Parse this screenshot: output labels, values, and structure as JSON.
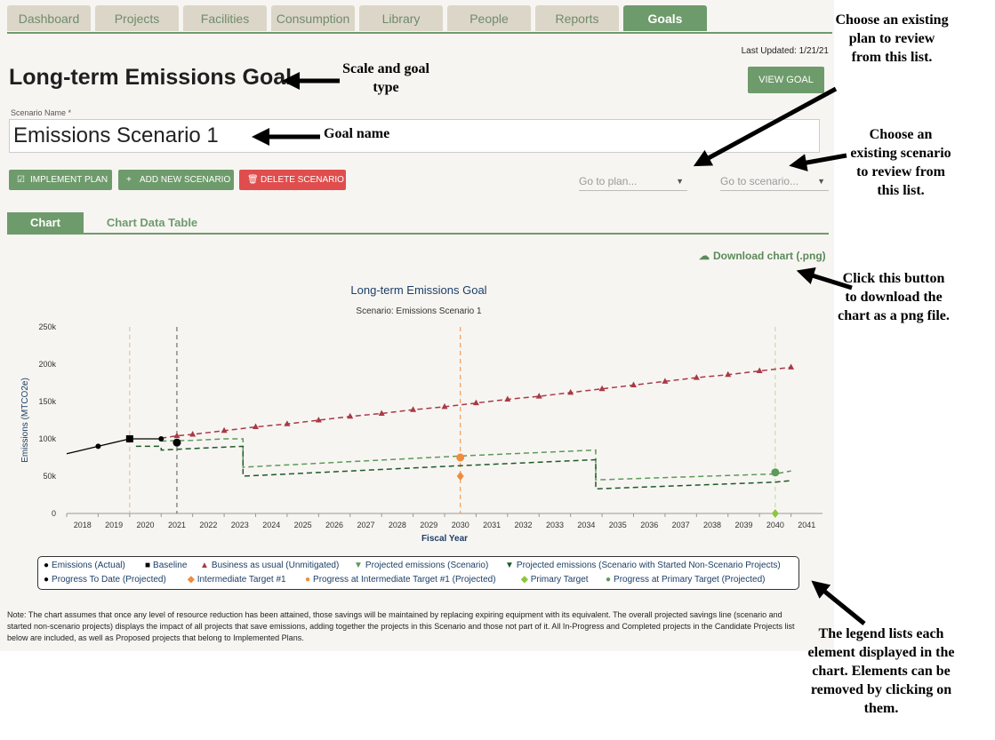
{
  "nav": {
    "tabs": [
      "Dashboard",
      "Projects",
      "Facilities",
      "Consumption",
      "Library",
      "People",
      "Reports",
      "Goals"
    ],
    "active": "Goals"
  },
  "header": {
    "last_updated": "Last Updated: 1/21/21",
    "title": "Long-term Emissions Goal",
    "view_goal": "VIEW GOAL"
  },
  "scenario": {
    "label": "Scenario Name *",
    "value": "Emissions Scenario 1"
  },
  "actions": {
    "implement": "IMPLEMENT PLAN",
    "add": "ADD NEW SCENARIO",
    "delete": "DELETE SCENARIO"
  },
  "selects": {
    "plan": "Go to plan...",
    "scenario": "Go to scenario..."
  },
  "subtabs": {
    "chart": "Chart",
    "table": "Chart Data Table"
  },
  "download": "Download chart (.png)",
  "colors": {
    "accent": "#6e9b6b",
    "danger": "#e04d4d",
    "bau": "#a83a45",
    "projected": "#5c9a59",
    "projected_started": "#1e5a28",
    "intermediate": "#f08c3a",
    "primary": "#8cc63f",
    "progress_primary": "#5c9a59"
  },
  "chart_data": {
    "type": "line",
    "title": "Long-term Emissions Goal",
    "subtitle": "Scenario: Emissions Scenario 1",
    "xlabel": "Fiscal Year",
    "ylabel": "Emissions (MTCO2e)",
    "x_ticks": [
      "2018",
      "2019",
      "2020",
      "2021",
      "2022",
      "2023",
      "2024",
      "2025",
      "2026",
      "2027",
      "2028",
      "2029",
      "2030",
      "2031",
      "2032",
      "2033",
      "2034",
      "2035",
      "2036",
      "2037",
      "2038",
      "2039",
      "2040",
      "2041"
    ],
    "y_ticks": [
      "0",
      "50k",
      "100k",
      "150k",
      "200k",
      "250k"
    ],
    "ylim": [
      0,
      250000
    ],
    "series": [
      {
        "name": "Emissions (Actual)",
        "points": [
          [
            2017.5,
            80000
          ],
          [
            2018.5,
            90000
          ],
          [
            2019.5,
            100000
          ],
          [
            2020.5,
            100000
          ]
        ]
      },
      {
        "name": "Baseline",
        "points": [
          [
            2019.5,
            100000
          ]
        ]
      },
      {
        "name": "Business as usual (Unmitigated)",
        "points": [
          [
            2020.5,
            101000
          ],
          [
            2021.0,
            104000
          ],
          [
            2021.5,
            106000
          ],
          [
            2022.5,
            111000
          ],
          [
            2023.5,
            116000
          ],
          [
            2024.5,
            120000
          ],
          [
            2025.5,
            125000
          ],
          [
            2026.5,
            130000
          ],
          [
            2027.5,
            134000
          ],
          [
            2028.5,
            139000
          ],
          [
            2029.5,
            143000
          ],
          [
            2030.5,
            148000
          ],
          [
            2031.5,
            153000
          ],
          [
            2032.5,
            157000
          ],
          [
            2033.5,
            162000
          ],
          [
            2034.5,
            167000
          ],
          [
            2035.5,
            172000
          ],
          [
            2036.5,
            177000
          ],
          [
            2037.5,
            182000
          ],
          [
            2038.5,
            186000
          ],
          [
            2039.5,
            191000
          ],
          [
            2040.5,
            196000
          ]
        ]
      },
      {
        "name": "Projected emissions (Scenario)",
        "points": [
          [
            2020.5,
            97000
          ],
          [
            2021.5,
            98000
          ],
          [
            2022.5,
            100000
          ],
          [
            2023.1,
            100000
          ],
          [
            2023.1,
            62000
          ],
          [
            2030,
            77000
          ],
          [
            2034.3,
            85000
          ],
          [
            2034.3,
            45000
          ],
          [
            2040,
            53000
          ],
          [
            2040.5,
            57000
          ]
        ]
      },
      {
        "name": "Projected emissions (Scenario with Started Non-Scenario Projects)",
        "points": [
          [
            2019.7,
            90000
          ],
          [
            2020.5,
            90000
          ],
          [
            2020.5,
            85000
          ],
          [
            2022,
            88000
          ],
          [
            2023.1,
            90000
          ],
          [
            2023.1,
            50000
          ],
          [
            2030,
            64000
          ],
          [
            2034.3,
            72000
          ],
          [
            2034.3,
            33000
          ],
          [
            2040,
            42000
          ],
          [
            2040.5,
            44000
          ]
        ]
      },
      {
        "name": "Progress To Date (Projected)",
        "points": [
          [
            2021.0,
            95000
          ]
        ]
      },
      {
        "name": "Intermediate Target #1",
        "points": [
          [
            2030,
            50000
          ]
        ]
      },
      {
        "name": "Progress at Intermediate Target #1 (Projected)",
        "points": [
          [
            2030,
            75000
          ]
        ]
      },
      {
        "name": "Primary Target",
        "points": [
          [
            2040,
            0
          ]
        ]
      },
      {
        "name": "Progress at Primary Target (Projected)",
        "points": [
          [
            2040,
            55000
          ]
        ]
      }
    ],
    "vertical_lines": [
      2019.5,
      2021.0,
      2030,
      2040
    ]
  },
  "legend": {
    "row1": [
      "Emissions (Actual)",
      "Baseline",
      "Business as usual (Unmitigated)",
      "Projected emissions (Scenario)",
      "Projected emissions (Scenario with Started Non-Scenario Projects)"
    ],
    "row2": [
      "Progress To Date (Projected)",
      "Intermediate Target #1",
      "Progress at Intermediate Target #1 (Projected)",
      "Primary Target",
      "Progress at Primary Target (Projected)"
    ]
  },
  "note": "Note: The chart assumes that once any level of resource reduction has been attained, those savings will be maintained by replacing expiring equipment with its equivalent. The overall projected savings line (scenario and started non-scenario projects) displays the impact of all projects that save emissions, adding together the projects in this Scenario and those not part of it. All In-Progress and Completed projects in the Candidate Projects list below are included, as well as Proposed projects that belong to Implemented Plans.",
  "annotations": {
    "scale": "Scale and goal type",
    "goal_name": "Goal name",
    "plan": "Choose an existing plan to review from this list.",
    "scenario": "Choose an existing scenario to review from this list.",
    "download": "Click this button to download the chart as a png file.",
    "legend": "The legend lists each element displayed in the chart. Elements can be removed by clicking on them."
  }
}
